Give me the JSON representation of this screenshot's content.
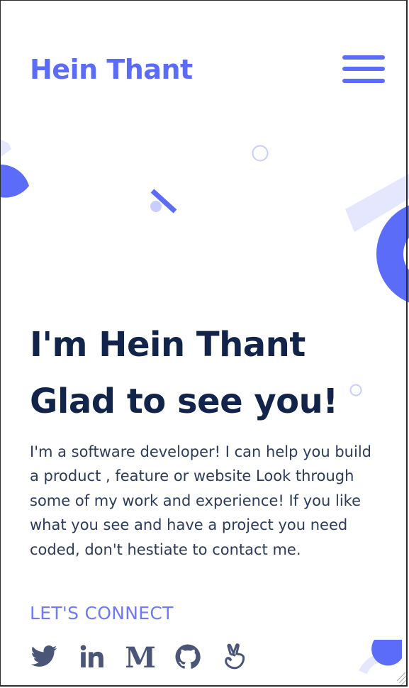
{
  "header": {
    "logo": "Hein Thant",
    "menu_icon": "hamburger-menu-icon"
  },
  "hero": {
    "heading_line1": "I'm Hein Thant",
    "heading_line2": "Glad to see you!",
    "intro": "I'm a software developer! I can help you build a product , feature or website Look through some of my work and experience! If you like what you see and have a project you need coded, don't hestiate to contact me.",
    "connect_label": "LET'S CONNECT"
  },
  "socials": [
    {
      "name": "twitter",
      "icon": "twitter-icon"
    },
    {
      "name": "linkedin",
      "icon": "linkedin-icon"
    },
    {
      "name": "medium",
      "icon": "medium-icon"
    },
    {
      "name": "github",
      "icon": "github-icon"
    },
    {
      "name": "angellist",
      "icon": "angellist-icon"
    }
  ],
  "colors": {
    "brand": "#5b6cf9",
    "heading": "#13244a",
    "body_text": "#2c3a5b",
    "social_icon": "#4a5578",
    "deco_light": "#e4e7fd"
  }
}
